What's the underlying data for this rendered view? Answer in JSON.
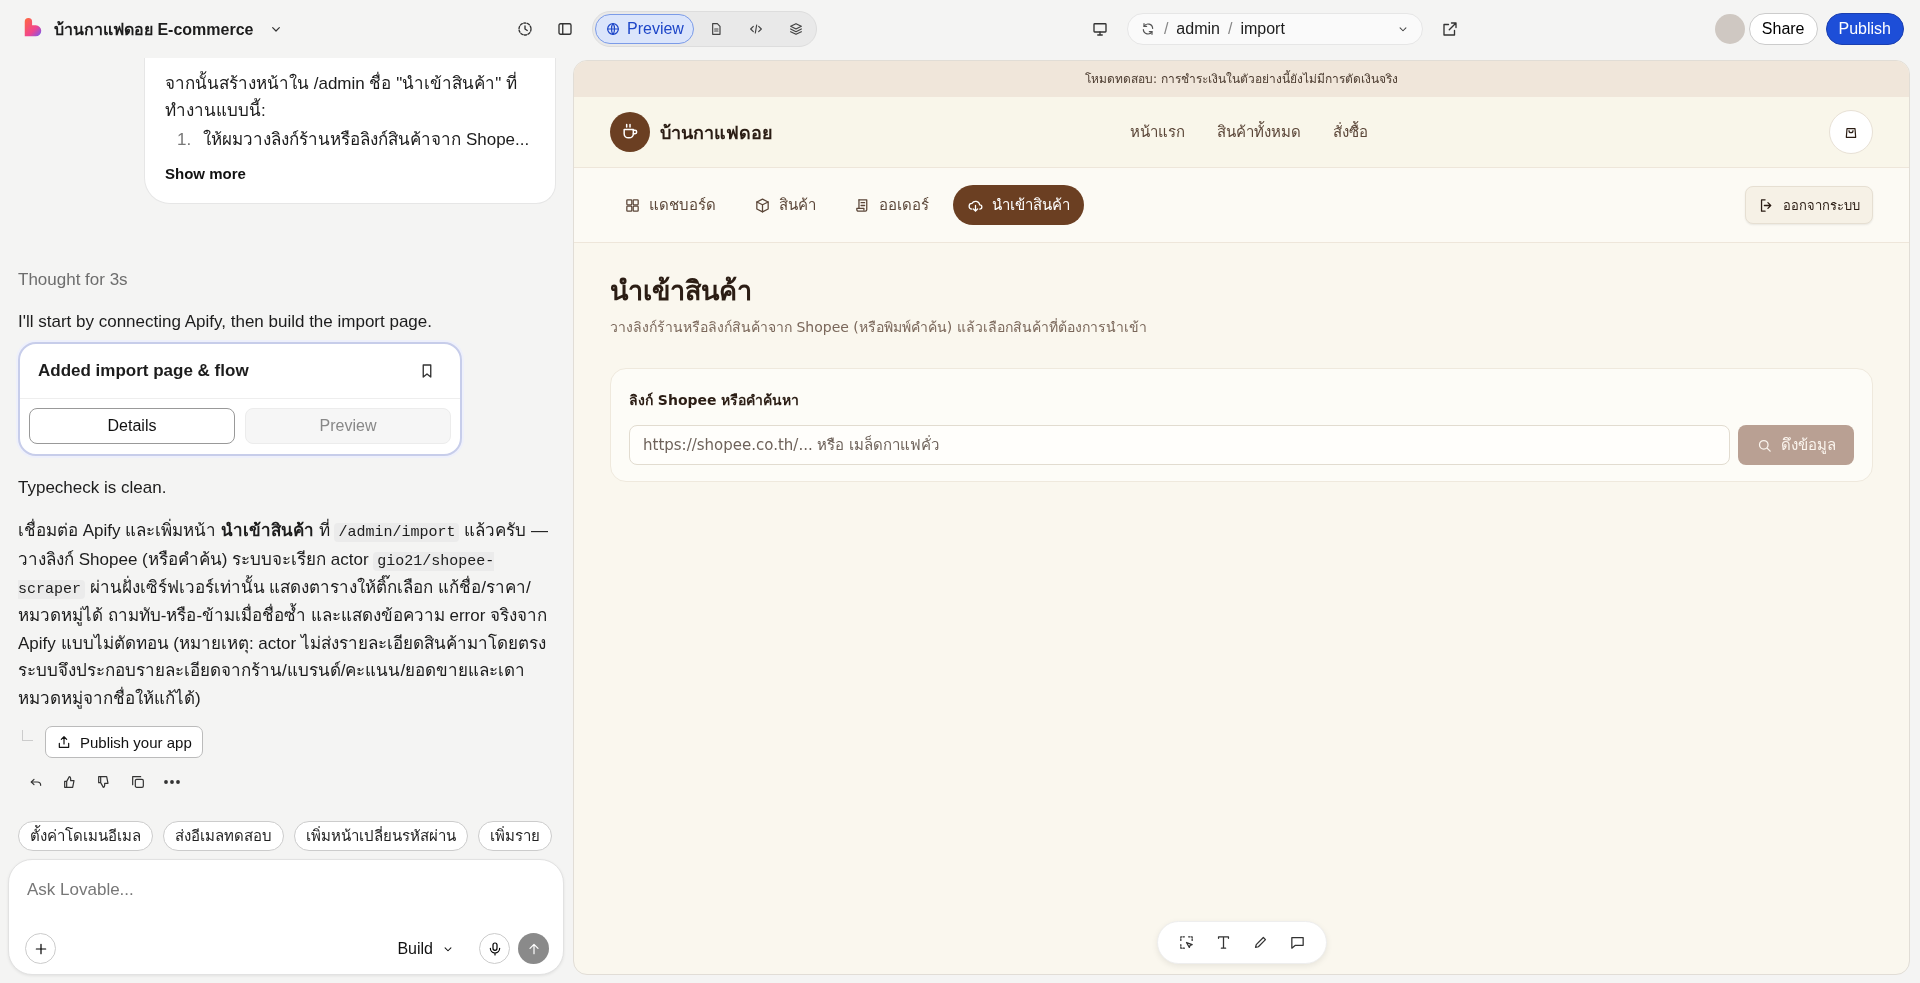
{
  "top_bar": {
    "project_title": "บ้านกาแฟดอย E-commerce",
    "view_tabs": [
      {
        "kind": "preview",
        "label": "Preview",
        "selected": true
      },
      {
        "kind": "file",
        "selected": false
      },
      {
        "kind": "code",
        "selected": false
      },
      {
        "kind": "layers",
        "selected": false
      }
    ],
    "url_path": [
      {
        "kind": "separator",
        "text": "/"
      },
      {
        "kind": "segment",
        "text": "admin"
      },
      {
        "kind": "separator",
        "text": "/"
      },
      {
        "kind": "segment",
        "text": "import"
      }
    ],
    "share_button": "Share",
    "publish_button": "Publish"
  },
  "chat": {
    "user_message": {
      "text": "จากนั้นสร้างหน้าใน /admin ชื่อ \"นำเข้าสินค้า\" ที่ทำงานแบบนี้:",
      "list_items": [
        {
          "number": "1.",
          "text": "ให้ผมวางลิงก์ร้านหรือลิงก์สินค้าจาก Shope..."
        }
      ],
      "show_more": "Show more"
    },
    "thought": "Thought for 3s",
    "intro": "I'll start by connecting Apify, then build the import page.",
    "action_card": {
      "title": "Added import page & flow",
      "buttons": [
        {
          "label": "Details",
          "selected": true
        },
        {
          "label": "Preview",
          "selected": false
        }
      ]
    },
    "status_text": "Typecheck is clean.",
    "summary": [
      {
        "kind": "text",
        "text": "เชื่อมต่อ Apify และเพิ่มหน้า **นำเข้าสินค้า** ที่ "
      },
      {
        "kind": "code",
        "text": "/admin/import"
      },
      {
        "kind": "text",
        "text": " แล้วครับ — วางลิงก์ Shopee (หรือคำค้น) ระบบจะเรียก actor "
      },
      {
        "kind": "code",
        "text": "gio21/shopee-scraper"
      },
      {
        "kind": "text",
        "text": " ผ่านฝั่งเซิร์ฟเวอร์เท่านั้น แสดงตารางให้ติ๊กเลือก แก้ชื่อ/ราคา/หมวดหมู่ได้ ถามทับ-หรือ-ข้ามเมื่อชื่อซ้ำ และแสดงข้อความ error จริงจาก Apify แบบไม่ตัดทอน (หมายเหตุ: actor ไม่ส่งรายละเอียดสินค้ามาโดยตรง ระบบจึงประกอบรายละเอียดจากร้าน/แบรนด์/คะแนน/ยอดขายและเดาหมวดหมู่จากชื่อให้แก้ได้)"
      }
    ],
    "publish_app_button": "Publish your app",
    "suggestions": [
      "ตั้งค่าโดเมนอีเมล",
      "ส่งอีเมลทดสอบ",
      "เพิ่มหน้าเปลี่ยนรหัสผ่าน",
      "เพิ่มราย"
    ],
    "composer": {
      "placeholder": "Ask Lovable...",
      "mode": "Build"
    }
  },
  "preview": {
    "banner": "โหมดทดสอบ: การชำระเงินในตัวอย่างนี้ยังไม่มีการตัดเงินจริง",
    "store_name": "บ้านกาแฟดอย",
    "nav_links": [
      "หน้าแรก",
      "สินค้าทั้งหมด",
      "สั่งซื้อ"
    ],
    "admin_tabs": [
      {
        "kind": "dashboard",
        "label": "แดชบอร์ด",
        "selected": false
      },
      {
        "kind": "products",
        "label": "สินค้า",
        "selected": false
      },
      {
        "kind": "orders",
        "label": "ออเดอร์",
        "selected": false
      },
      {
        "kind": "import",
        "label": "นำเข้าสินค้า",
        "selected": true
      }
    ],
    "logout_button": "ออกจากระบบ",
    "page_title": "นำเข้าสินค้า",
    "page_subtitle": "วางลิงก์ร้านหรือลิงก์สินค้าจาก Shopee (หรือพิมพ์คำค้น) แล้วเลือกสินค้าที่ต้องการนำเข้า",
    "search_label": "ลิงก์ Shopee หรือคำค้นหา",
    "search_placeholder": "https://shopee.co.th/... หรือ เมล็ดกาแฟคั่ว",
    "fetch_button": {
      "label": "ดึงข้อมูล",
      "disabled": true
    }
  }
}
